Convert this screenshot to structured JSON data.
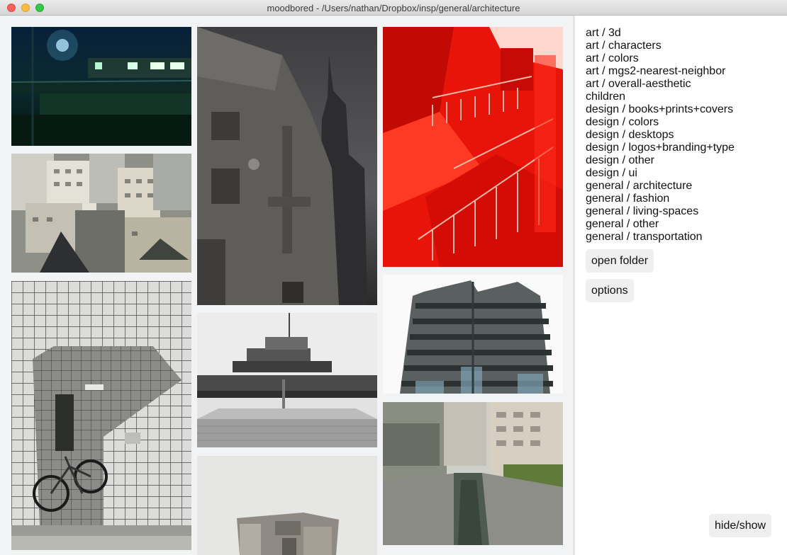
{
  "window": {
    "title": "moodbored - /Users/nathan/Dropbox/insp/general/architecture"
  },
  "gallery": {
    "photos": [
      {
        "name": "night-train-photo",
        "icon": "night-train"
      },
      {
        "name": "apartment-blocks-photo",
        "icon": "apartment-blocks"
      },
      {
        "name": "tiled-entrance-bicycle-photo",
        "icon": "tiled-entrance"
      },
      {
        "name": "concrete-tower-photo",
        "icon": "concrete-tower"
      },
      {
        "name": "brutalist-museum-photo",
        "icon": "brutalist-museum"
      },
      {
        "name": "wooden-model-photo",
        "icon": "wooden-model"
      },
      {
        "name": "red-stairwell-photo",
        "icon": "red-stairwell"
      },
      {
        "name": "stacked-balconies-tower-photo",
        "icon": "stacked-balconies"
      },
      {
        "name": "canal-buildings-photo",
        "icon": "canal"
      }
    ]
  },
  "sidebar": {
    "folders": [
      "art / 3d",
      "art / characters",
      "art / colors",
      "art / mgs2-nearest-neighbor",
      "art / overall-aesthetic",
      "children",
      "design / books+prints+covers",
      "design / colors",
      "design / desktops",
      "design / logos+branding+type",
      "design / other",
      "design / ui",
      "general / architecture",
      "general / fashion",
      "general / living-spaces",
      "general / other",
      "general / transportation"
    ],
    "open_folder_label": "open folder",
    "options_label": "options",
    "hide_show_label": "hide/show"
  },
  "colors": {
    "gallery_bg": "#f2f3f5",
    "sidebar_bg": "#ffffff",
    "button_bg": "#efefef",
    "close": "#fc605c",
    "minimize": "#fdbc40",
    "maximize": "#34c84a"
  }
}
